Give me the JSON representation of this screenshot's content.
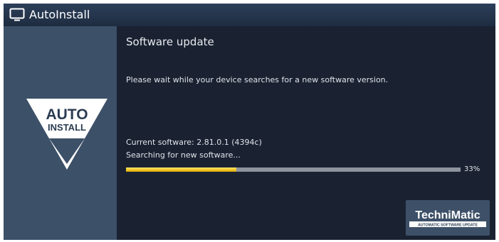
{
  "window": {
    "title": "AutoInstall",
    "icon": "tv-icon"
  },
  "sidebar": {
    "logo_line1": "AUTO",
    "logo_line2": "INSTALL",
    "logo_icon": "auto-install-triangle-icon"
  },
  "main": {
    "section_title": "Software update",
    "message": "Please wait while your device searches for a new software version.",
    "current_software": "Current software: 2.81.0.1 (4394c)",
    "status": "Searching for new software...",
    "progress": {
      "percent_label": "33%",
      "value": 0.33
    }
  },
  "brand": {
    "name": "TechniMatic",
    "tagline": "AUTOMATIC SOFTWARE UPDATE"
  },
  "colors": {
    "screen_bg": "#1a2232",
    "panel_bg": "#3c5068",
    "progress_fill": "#f3c623",
    "progress_track": "#8e949c",
    "text": "#dfe3e9"
  }
}
